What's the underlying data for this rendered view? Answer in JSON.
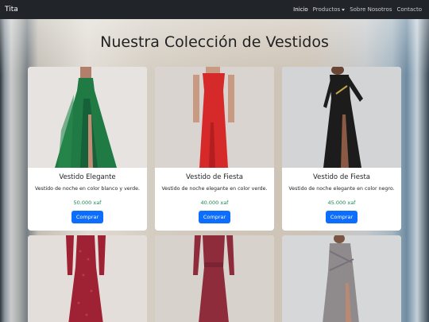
{
  "navbar": {
    "brand": "Tita",
    "links": [
      {
        "label": "Inicio"
      },
      {
        "label": "Productos"
      },
      {
        "label": "Sobre Nosotros"
      },
      {
        "label": "Contacto"
      }
    ]
  },
  "page": {
    "title": "Nuestra Colección de Vestidos"
  },
  "products": [
    {
      "title": "Vestido Elegante",
      "description": "Vestido de noche en color blanco y verde.",
      "price": "50.000 xaf",
      "button": "Comprar",
      "dress_color": "#1f7a43"
    },
    {
      "title": "Vestido de Fiesta",
      "description": "Vestido de noche elegante en color verde.",
      "price": "40.000 xaf",
      "button": "Comprar",
      "dress_color": "#d62a2a"
    },
    {
      "title": "Vestido de Fiesta",
      "description": "Vestido de noche elegante en color negro.",
      "price": "45.000 xaf",
      "button": "Comprar",
      "dress_color": "#1c1c1c"
    },
    {
      "dress_color": "#9e2233"
    },
    {
      "dress_color": "#8e2c3c"
    },
    {
      "dress_color": "#8f8a8c"
    }
  ]
}
